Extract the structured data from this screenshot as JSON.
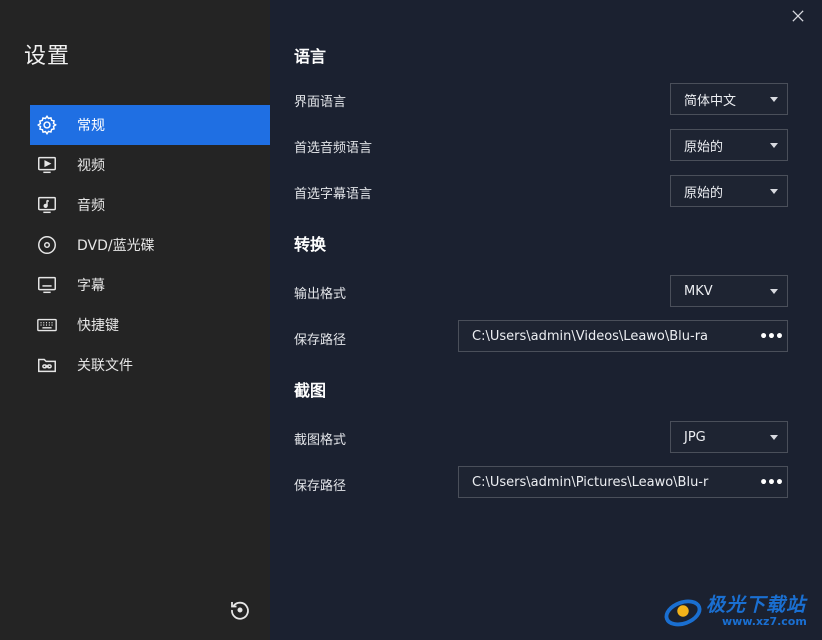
{
  "sidebar": {
    "title": "设置",
    "items": [
      {
        "label": "常规",
        "icon": "gear-icon",
        "active": true
      },
      {
        "label": "视频",
        "icon": "video-icon"
      },
      {
        "label": "音频",
        "icon": "audio-icon"
      },
      {
        "label": "DVD/蓝光碟",
        "icon": "disc-icon"
      },
      {
        "label": "字幕",
        "icon": "subtitle-icon"
      },
      {
        "label": "快捷键",
        "icon": "keyboard-icon"
      },
      {
        "label": "关联文件",
        "icon": "folder-link-icon"
      }
    ],
    "reset_icon": "reset-icon"
  },
  "window": {
    "close_icon": "close-icon"
  },
  "language": {
    "title": "语言",
    "ui_language_label": "界面语言",
    "ui_language_value": "简体中文",
    "audio_language_label": "首选音频语言",
    "audio_language_value": "原始的",
    "subtitle_language_label": "首选字幕语言",
    "subtitle_language_value": "原始的"
  },
  "convert": {
    "title": "转换",
    "output_format_label": "输出格式",
    "output_format_value": "MKV",
    "save_path_label": "保存路径",
    "save_path_value": "C:\\Users\\admin\\Videos\\Leawo\\Blu-ra"
  },
  "screenshot": {
    "title": "截图",
    "format_label": "截图格式",
    "format_value": "JPG",
    "save_path_label": "保存路径",
    "save_path_value": "C:\\Users\\admin\\Pictures\\Leawo\\Blu-r"
  },
  "browse_label": "•••",
  "watermark": {
    "text": "极光下载站",
    "url": "www.xz7.com"
  },
  "colors": {
    "accent": "#1f6fe3",
    "sidebar_bg": "#242424",
    "main_bg": "#1b2130"
  }
}
